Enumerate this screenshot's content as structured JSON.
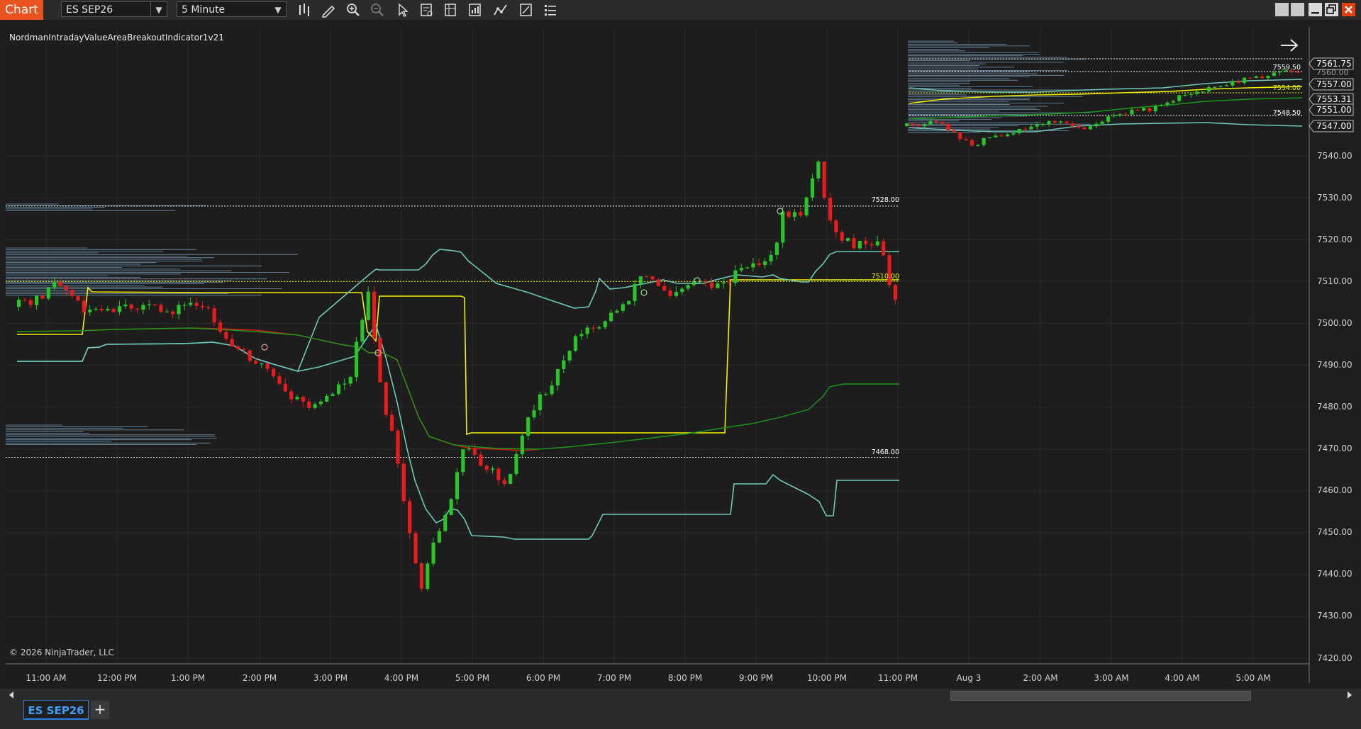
{
  "toolbar": {
    "chart_tab": "Chart",
    "instrument": "ES SEP26",
    "interval": "5 Minute",
    "tools": [
      "bar-type-icon",
      "draw-pencil-icon",
      "zoom-in-icon",
      "zoom-out-icon",
      "pointer-icon",
      "data-box-icon",
      "properties-icon",
      "strategies-icon",
      "indicators-icon",
      "templates-icon",
      "menu-list-icon"
    ]
  },
  "chart": {
    "indicator_name": "NordmanIntradayValueAreaBreakoutIndicator1v21",
    "copyright": "© 2026 NinjaTrader, LLC",
    "y_axis_labels": [
      "7540.00",
      "7530.00",
      "7520.00",
      "7510.00",
      "7500.00",
      "7490.00",
      "7480.00",
      "7470.00",
      "7460.00",
      "7450.00",
      "7440.00",
      "7430.00",
      "7420.00"
    ],
    "x_axis_labels": [
      "11:00 AM",
      "12:00 PM",
      "1:00 PM",
      "2:00 PM",
      "3:00 PM",
      "4:00 PM",
      "5:00 PM",
      "6:00 PM",
      "7:00 PM",
      "8:00 PM",
      "9:00 PM",
      "10:00 PM",
      "11:00 PM",
      "Aug 3",
      "2:00 AM",
      "3:00 AM",
      "4:00 AM",
      "5:00 AM"
    ],
    "price_tags": [
      {
        "label": "7561.75",
        "kind": "last"
      },
      {
        "label": "7560.00",
        "kind": "hidden"
      },
      {
        "label": "7557.00",
        "kind": "vah"
      },
      {
        "label": "7553.31",
        "kind": "mid"
      },
      {
        "label": "7551.00",
        "kind": "poc"
      },
      {
        "label": "7547.00",
        "kind": "val"
      }
    ],
    "level_labels": [
      {
        "label": "7528.00",
        "color": "#ffffff"
      },
      {
        "label": "7510.00",
        "color": "#f2f200"
      },
      {
        "label": "7468.00",
        "color": "#ffffff"
      },
      {
        "label": "7559.50",
        "color": "#ffffff"
      },
      {
        "label": "7554.00",
        "color": "#f2f200"
      },
      {
        "label": "7548.50",
        "color": "#ffffff"
      }
    ],
    "colors": {
      "background": "#1e1e1e",
      "up_candle": "#28c428",
      "down_candle": "#e81c1c",
      "vah_val_band": "#6ec9b8",
      "poc": "#f2f200",
      "ema_red": "#d81818",
      "vwap_green": "#1a9a1a",
      "profile": "#7ea8c8",
      "accent": "#e8531e"
    }
  },
  "instrument_tab": "ES SEP26"
}
